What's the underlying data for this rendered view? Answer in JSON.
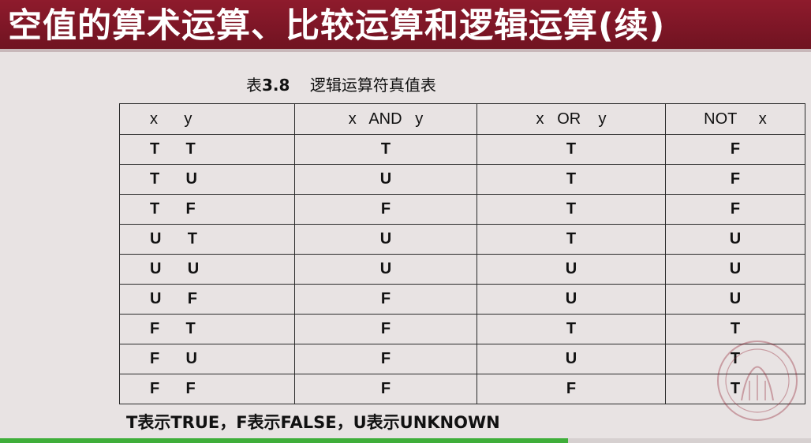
{
  "slide": {
    "title": "空值的算术运算、比较运算和逻辑运算(续)",
    "caption_prefix": "表",
    "caption_number": "3.8",
    "caption_text": "逻辑运算符真值表",
    "footnote": "T表示TRUE，F表示FALSE，U表示UNKNOWN"
  },
  "table": {
    "headers": [
      "x      y",
      "x   AND   y",
      "x   OR    y",
      "NOT     x"
    ],
    "rows": [
      [
        "T      T",
        "T",
        "T",
        "F"
      ],
      [
        "T      U",
        "U",
        "T",
        "F"
      ],
      [
        "T      F",
        "F",
        "T",
        "F"
      ],
      [
        "U      T",
        "U",
        "T",
        "U"
      ],
      [
        "U      U",
        "U",
        "U",
        "U"
      ],
      [
        "U      F",
        "F",
        "U",
        "U"
      ],
      [
        "F      T",
        "F",
        "T",
        "T"
      ],
      [
        "F      U",
        "F",
        "U",
        "T"
      ],
      [
        "F      F",
        "F",
        "F",
        "T"
      ]
    ]
  },
  "colors": {
    "title_bar": "#7d1626",
    "background": "#e8e3e3",
    "progress": "#3fae3a"
  },
  "video_progress": 0.7
}
